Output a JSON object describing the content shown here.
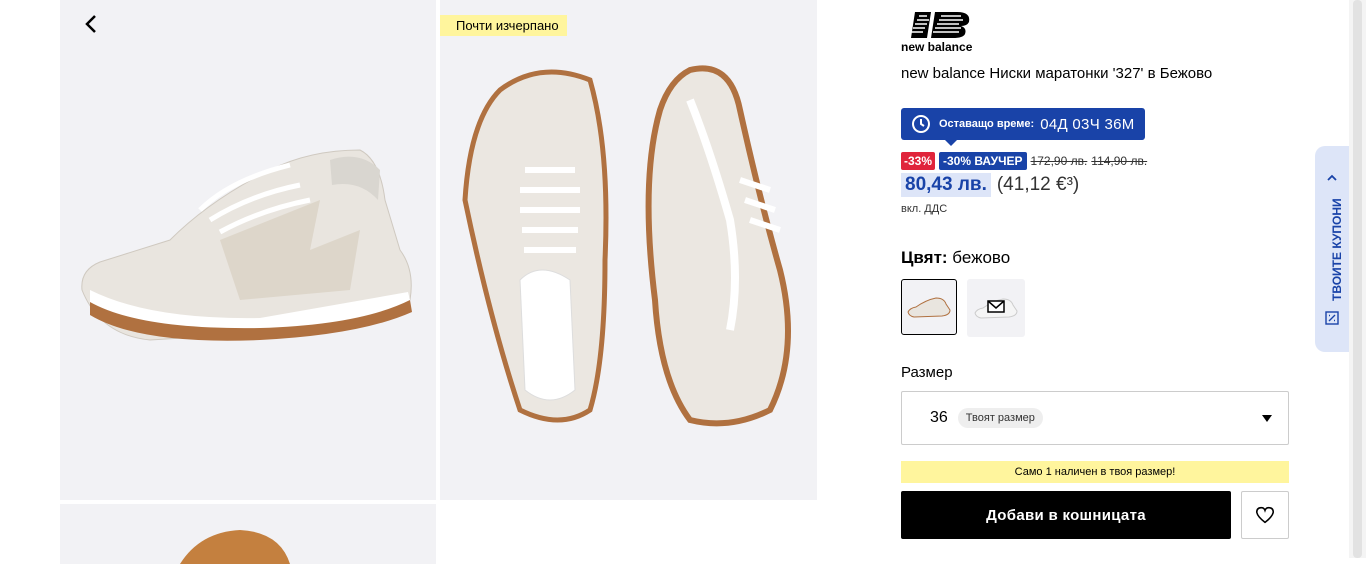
{
  "gallery": {
    "badge_low_stock": "Почти изчерпано"
  },
  "brand": {
    "logo_text": "new balance"
  },
  "product": {
    "title": "new balance Ниски маратонки '327' в Бежово"
  },
  "timer": {
    "label": "Оставащо време:",
    "value": "04Д 03Ч 36М"
  },
  "pricing": {
    "discount_badge": "-33%",
    "voucher_badge": "-30% ВАУЧЕР",
    "old_price_1": "172,90 лв.",
    "old_price_2": "114,90 лв.",
    "current_price": "80,43 лв.",
    "eur_price": "(41,12 €³)",
    "vat_note": "вкл. ДДС"
  },
  "color": {
    "label": "Цвят:",
    "value": "бежово"
  },
  "size": {
    "label": "Размер",
    "selected": "36",
    "pill": "Твоят размер"
  },
  "stock_note": "Само 1 наличен в твоя размер!",
  "cart": {
    "add_label": "Добави в кошницата"
  },
  "coupons": {
    "label": "ТВОИТЕ КУПОНИ"
  },
  "colors": {
    "accent": "#1943a8",
    "discount_red": "#e0243b",
    "highlight_yellow": "#fff59d",
    "tile_bg": "#f2f2f5"
  }
}
